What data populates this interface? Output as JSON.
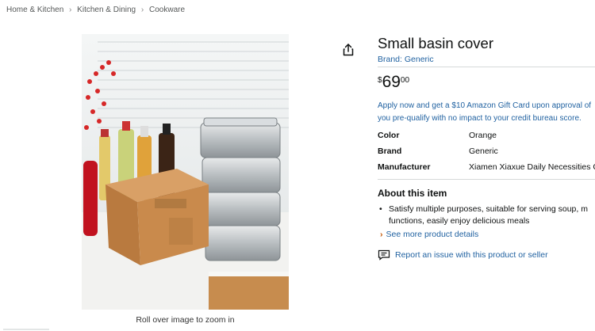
{
  "breadcrumb": [
    "Home & Kitchen",
    "Kitchen & Dining",
    "Cookware"
  ],
  "breadcrumb_separator": "›",
  "image": {
    "zoom_hint": "Roll over image to zoom in"
  },
  "product": {
    "title": "Small basin cover",
    "brand_link": "Brand: Generic",
    "price": {
      "symbol": "$",
      "whole": "69",
      "fraction": "00"
    },
    "promo": [
      "Apply now and get a $10 Amazon Gift Card upon approval of",
      "you pre-qualify with no impact to your credit bureau score."
    ],
    "specs": [
      {
        "key": "Color",
        "value": "Orange"
      },
      {
        "key": "Brand",
        "value": "Generic"
      },
      {
        "key": "Manufacturer",
        "value": "Xiamen Xiaxue Daily Necessities C"
      }
    ],
    "about": {
      "title": "About this item",
      "bullets": [
        [
          "Satisfy multiple purposes, suitable for serving soup, m",
          "functions, easily enjoy delicious meals"
        ]
      ],
      "see_more": "See more product details"
    },
    "report_link": "Report an issue with this product or seller"
  },
  "colors": {
    "link": "#2162a1",
    "accent": "#c45500",
    "text": "#0f1111",
    "muted": "#565959"
  },
  "icons": {
    "share": "share-icon",
    "report": "report-flag-icon"
  }
}
